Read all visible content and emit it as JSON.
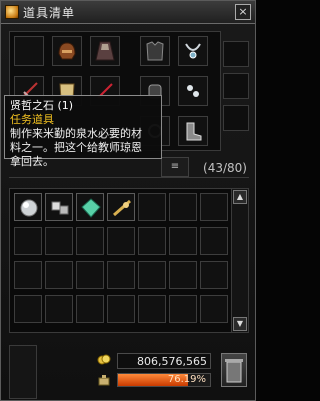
{
  "window": {
    "title": "道具清单",
    "close_glyph": "×"
  },
  "inventory": {
    "count_label": "(43/80)"
  },
  "tooltip": {
    "name": "贤哲之石 (1)",
    "type": "任务道具",
    "desc_line1": "制作来米勤的泉水必要的材",
    "desc_line2": "料之一。把这个给教师琼恩",
    "desc_line3": "拿回去。"
  },
  "footer": {
    "money": "806,576,565",
    "weight": "76.19%",
    "weight_fraction": 0.76
  },
  "colors": {
    "tooltip_type": "#f0c020",
    "weight_bar": "#e8601a"
  }
}
